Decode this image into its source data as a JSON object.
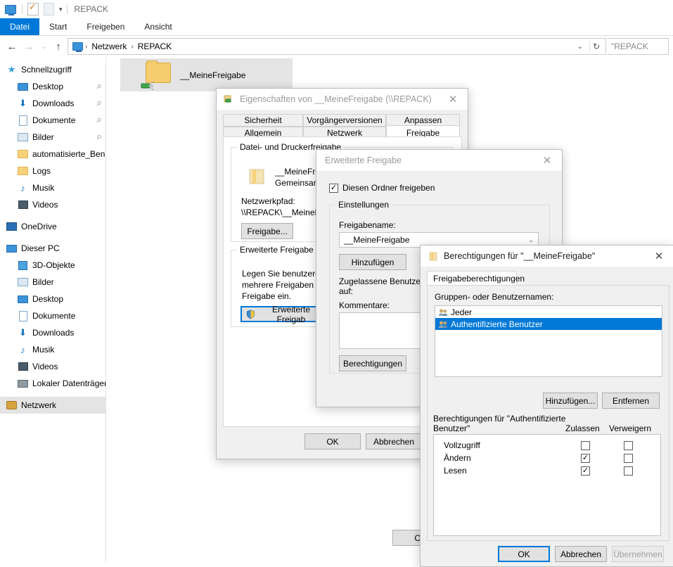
{
  "explorer": {
    "window_title": "REPACK",
    "quick_access_icons": [
      "monitor-icon",
      "properties-icon",
      "new-folder-icon",
      "customize-chevron-icon"
    ],
    "ribbon_tabs": [
      {
        "label": "Datei",
        "active": true
      },
      {
        "label": "Start",
        "active": false
      },
      {
        "label": "Freigeben",
        "active": false
      },
      {
        "label": "Ansicht",
        "active": false
      }
    ],
    "nav": {
      "back": "←",
      "forward": "→",
      "recent": "⌄",
      "up": "↑"
    },
    "breadcrumb": [
      "Netzwerk",
      "REPACK"
    ],
    "search_value": "\"REPACK",
    "sidebar": [
      {
        "label": "Schnellzugriff",
        "icon": "star-icon",
        "level": 0,
        "pinned": false,
        "selected": false
      },
      {
        "label": "Desktop",
        "icon": "desktop-icon",
        "level": 1,
        "pinned": true,
        "selected": false
      },
      {
        "label": "Downloads",
        "icon": "download-icon",
        "level": 1,
        "pinned": true,
        "selected": false
      },
      {
        "label": "Dokumente",
        "icon": "documents-icon",
        "level": 1,
        "pinned": true,
        "selected": false
      },
      {
        "label": "Bilder",
        "icon": "pictures-icon",
        "level": 1,
        "pinned": true,
        "selected": false
      },
      {
        "label": "automatisierte_Benu",
        "icon": "folder-icon",
        "level": 1,
        "pinned": false,
        "selected": false
      },
      {
        "label": "Logs",
        "icon": "folder-icon",
        "level": 1,
        "pinned": false,
        "selected": false
      },
      {
        "label": "Musik",
        "icon": "music-icon",
        "level": 1,
        "pinned": false,
        "selected": false
      },
      {
        "label": "Videos",
        "icon": "video-icon",
        "level": 1,
        "pinned": false,
        "selected": false
      },
      {
        "label": "OneDrive",
        "icon": "onedrive-icon",
        "level": 0,
        "pinned": false,
        "selected": false
      },
      {
        "label": "Dieser PC",
        "icon": "computer-icon",
        "level": 0,
        "pinned": false,
        "selected": false
      },
      {
        "label": "3D-Objekte",
        "icon": "3d-objects-icon",
        "level": 1,
        "pinned": false,
        "selected": false
      },
      {
        "label": "Bilder",
        "icon": "pictures-icon",
        "level": 1,
        "pinned": false,
        "selected": false
      },
      {
        "label": "Desktop",
        "icon": "desktop-icon",
        "level": 1,
        "pinned": false,
        "selected": false
      },
      {
        "label": "Dokumente",
        "icon": "documents-icon",
        "level": 1,
        "pinned": false,
        "selected": false
      },
      {
        "label": "Downloads",
        "icon": "download-icon",
        "level": 1,
        "pinned": false,
        "selected": false
      },
      {
        "label": "Musik",
        "icon": "music-icon",
        "level": 1,
        "pinned": false,
        "selected": false
      },
      {
        "label": "Videos",
        "icon": "video-icon",
        "level": 1,
        "pinned": false,
        "selected": false
      },
      {
        "label": "Lokaler Datenträger",
        "icon": "drive-icon",
        "level": 1,
        "pinned": false,
        "selected": false
      },
      {
        "label": "Netzwerk",
        "icon": "network-icon",
        "level": 0,
        "pinned": false,
        "selected": true
      }
    ],
    "file_item": {
      "name": "__MeineFreigabe",
      "icon": "shared-folder-icon"
    }
  },
  "properties_dialog": {
    "title": "Eigenschaften von __MeineFreigabe (\\\\REPACK)",
    "title_icon": "share-properties-icon",
    "close": "✕",
    "tabs_row1": [
      "Sicherheit",
      "Vorgängerversionen",
      "Anpassen"
    ],
    "tabs_row2": [
      "Allgemein",
      "Netzwerk",
      "Freigabe"
    ],
    "selected_tab": "Freigabe",
    "group1_label": "Datei- und Druckerfreigabe",
    "share_name": "__MeineFreigabe",
    "share_state": "Gemeinsam v",
    "network_path_label": "Netzwerkpfad:",
    "network_path_value": "\\\\REPACK\\__MeineFre",
    "share_button": "Freigabe...",
    "group2_label": "Erweiterte Freigabe",
    "group2_text_line1": "Legen Sie benutzerdefi",
    "group2_text_line2": "mehrere Freigaben und",
    "group2_text_line3": "Freigabe ein.",
    "advanced_button": "Erweiterte Freigab",
    "advanced_button_icon": "shield-icon",
    "ok": "OK",
    "cancel": "Abbrechen"
  },
  "advanced_share_dialog": {
    "title": "Erweiterte Freigabe",
    "close": "✕",
    "share_folder_checkbox": {
      "label": "Diesen Ordner freigeben",
      "checked": true
    },
    "settings_group": "Einstellungen",
    "share_name_label": "Freigabename:",
    "share_name_value": "__MeineFreigabe",
    "add_button": "Hinzufügen",
    "users_label_line1": "Zugelassene Benutzera",
    "users_label_line2": "auf:",
    "comments_label": "Kommentare:",
    "comments_value": "",
    "permissions_button": "Berechtigungen",
    "ok": "OK"
  },
  "permissions_dialog": {
    "title": "Berechtigungen für \"__MeineFreigabe\"",
    "title_icon": "folder-icon",
    "close": "✕",
    "tab": "Freigabeberechtigungen",
    "names_label": "Gruppen- oder Benutzernamen:",
    "names": [
      {
        "label": "Jeder",
        "icon": "users-group-icon",
        "selected": false
      },
      {
        "label": "Authentifizierte Benutzer",
        "icon": "users-group-icon",
        "selected": true
      }
    ],
    "add_button": "Hinzufügen...",
    "remove_button": "Entfernen",
    "perm_header_line1": "Berechtigungen für \"Authentifizierte",
    "perm_header_line2": "Benutzer\"",
    "col_allow": "Zulassen",
    "col_deny": "Verweigern",
    "permissions": [
      {
        "name": "Vollzugriff",
        "allow": false,
        "deny": false
      },
      {
        "name": "Ändern",
        "allow": true,
        "deny": false
      },
      {
        "name": "Lesen",
        "allow": true,
        "deny": false
      }
    ],
    "ok": "OK",
    "cancel": "Abbrechen",
    "apply": "Übernehmen",
    "apply_disabled": true
  },
  "colors": {
    "accent": "#0078d7",
    "ribbon_active_bg": "#0078d7",
    "selection_bg": "#0078d7",
    "dialog_bg": "#f0f0f0",
    "button_bg": "#e1e1e1",
    "tile_selected": "#e4e4e4"
  }
}
